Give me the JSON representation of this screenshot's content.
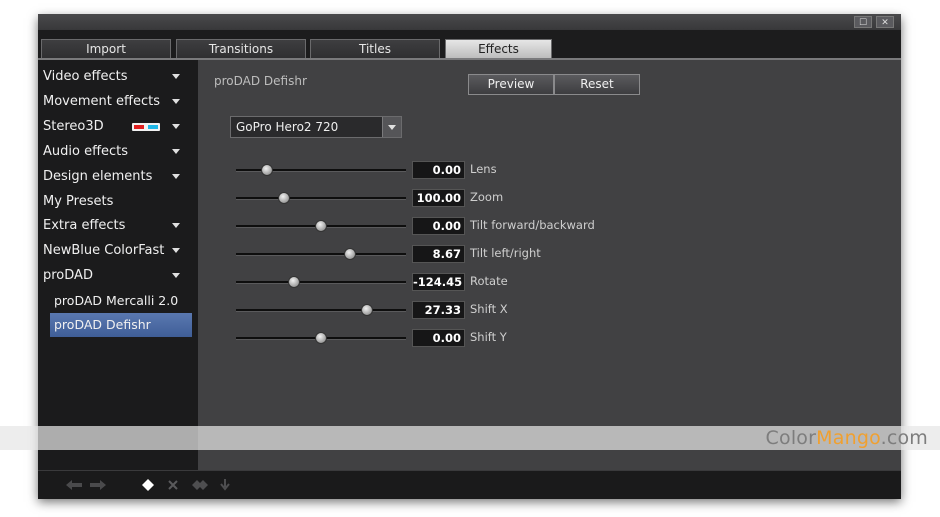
{
  "window": {
    "controls": {
      "restore": "☐",
      "close": "✕"
    }
  },
  "tabs": [
    {
      "label": "Import",
      "active": false
    },
    {
      "label": "Transitions",
      "active": false
    },
    {
      "label": "Titles",
      "active": false
    },
    {
      "label": "Effects",
      "active": true
    }
  ],
  "sidebar": {
    "items": [
      {
        "label": "Video effects",
        "expandable": true
      },
      {
        "label": "Movement effects",
        "expandable": true
      },
      {
        "label": "Stereo3D",
        "expandable": true,
        "icon": "3d-glasses-icon"
      },
      {
        "label": "Audio effects",
        "expandable": true
      },
      {
        "label": "Design elements",
        "expandable": true
      },
      {
        "label": "My Presets",
        "expandable": false
      },
      {
        "label": "Extra effects",
        "expandable": true
      },
      {
        "label": "NewBlue ColorFast",
        "expandable": true
      },
      {
        "label": "proDAD",
        "expandable": true
      },
      {
        "label": "proDAD Mercalli 2.0",
        "sub": true
      },
      {
        "label": "proDAD Defishr",
        "sub": true,
        "selected": true
      }
    ]
  },
  "main": {
    "plugin_name": "proDAD Defishr",
    "preview_label": "Preview",
    "reset_label": "Reset",
    "preset": "GoPro Hero2 720",
    "params": [
      {
        "label": "Lens",
        "value": "0.00",
        "level": 0.18
      },
      {
        "label": "Zoom",
        "value": "100.00",
        "level": 0.28
      },
      {
        "label": "Tilt forward/backward",
        "value": "0.00",
        "level": 0.5
      },
      {
        "label": "Tilt left/right",
        "value": "8.67",
        "level": 0.67
      },
      {
        "label": "Rotate",
        "value": "-124.45",
        "level": 0.34
      },
      {
        "label": "Shift X",
        "value": "27.33",
        "level": 0.77
      },
      {
        "label": "Shift Y",
        "value": "0.00",
        "level": 0.5
      }
    ]
  },
  "watermark": {
    "part1": "Color",
    "part2": "Mango",
    "part3": ".com"
  },
  "bottom": {
    "icons": [
      "undo-icon",
      "redo-icon",
      "keyframe-add-icon",
      "keyframe-delete-icon",
      "keyframe-prev-icon",
      "keyframe-next-icon"
    ]
  },
  "colors": {
    "accent_selected": "#4a6aa6",
    "panel": "#414143",
    "sidebar": "#1b1b1c",
    "watermark_orange": "#f0a030"
  }
}
